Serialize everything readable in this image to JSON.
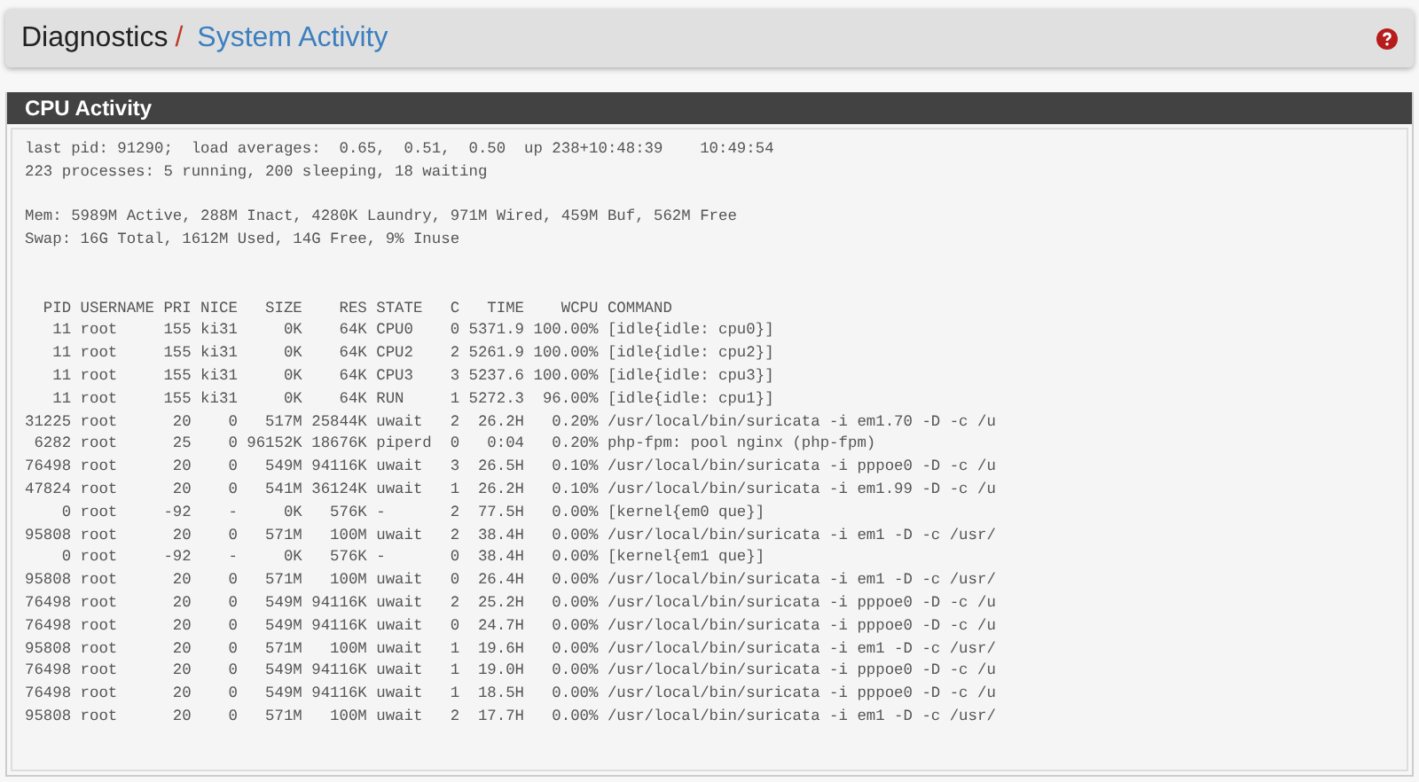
{
  "breadcrumb": {
    "section": "Diagnostics",
    "separator": "/",
    "page": "System Activity"
  },
  "panel": {
    "title": "CPU Activity",
    "summary": [
      "last pid: 91290;  load averages:  0.65,  0.51,  0.50  up 238+10:48:39    10:49:54",
      "223 processes: 5 running, 200 sleeping, 18 waiting"
    ],
    "memory": [
      "Mem: 5989M Active, 288M Inact, 4280K Laundry, 971M Wired, 459M Buf, 562M Free",
      "Swap: 16G Total, 1612M Used, 14G Free, 9% Inuse"
    ],
    "process_header": "  PID USERNAME PRI NICE   SIZE    RES STATE   C   TIME    WCPU COMMAND",
    "process_rows": [
      "   11 root     155 ki31     0K    64K CPU0    0 5371.9 100.00% [idle{idle: cpu0}]",
      "   11 root     155 ki31     0K    64K CPU2    2 5261.9 100.00% [idle{idle: cpu2}]",
      "   11 root     155 ki31     0K    64K CPU3    3 5237.6 100.00% [idle{idle: cpu3}]",
      "   11 root     155 ki31     0K    64K RUN     1 5272.3  96.00% [idle{idle: cpu1}]",
      "31225 root      20    0   517M 25844K uwait   2  26.2H   0.20% /usr/local/bin/suricata -i em1.70 -D -c /u",
      " 6282 root      25    0 96152K 18676K piperd  0   0:04   0.20% php-fpm: pool nginx (php-fpm)",
      "76498 root      20    0   549M 94116K uwait   3  26.5H   0.10% /usr/local/bin/suricata -i pppoe0 -D -c /u",
      "47824 root      20    0   541M 36124K uwait   1  26.2H   0.10% /usr/local/bin/suricata -i em1.99 -D -c /u",
      "    0 root     -92    -     0K   576K -       2  77.5H   0.00% [kernel{em0 que}]",
      "95808 root      20    0   571M   100M uwait   2  38.4H   0.00% /usr/local/bin/suricata -i em1 -D -c /usr/",
      "    0 root     -92    -     0K   576K -       0  38.4H   0.00% [kernel{em1 que}]",
      "95808 root      20    0   571M   100M uwait   0  26.4H   0.00% /usr/local/bin/suricata -i em1 -D -c /usr/",
      "76498 root      20    0   549M 94116K uwait   2  25.2H   0.00% /usr/local/bin/suricata -i pppoe0 -D -c /u",
      "76498 root      20    0   549M 94116K uwait   0  24.7H   0.00% /usr/local/bin/suricata -i pppoe0 -D -c /u",
      "95808 root      20    0   571M   100M uwait   1  19.6H   0.00% /usr/local/bin/suricata -i em1 -D -c /usr/",
      "76498 root      20    0   549M 94116K uwait   1  19.0H   0.00% /usr/local/bin/suricata -i pppoe0 -D -c /u",
      "76498 root      20    0   549M 94116K uwait   1  18.5H   0.00% /usr/local/bin/suricata -i pppoe0 -D -c /u",
      "95808 root      20    0   571M   100M uwait   2  17.7H   0.00% /usr/local/bin/suricata -i em1 -D -c /usr/"
    ]
  }
}
